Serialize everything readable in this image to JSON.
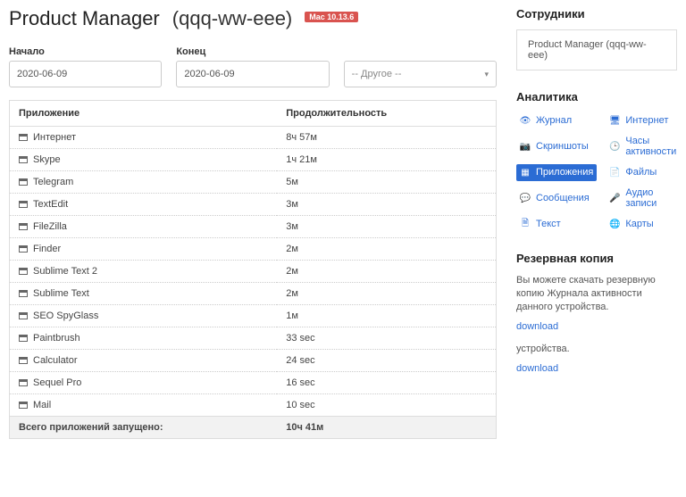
{
  "header": {
    "name": "Product Manager",
    "device": "(qqq-ww-eee)",
    "badge": "Mac 10.13.6"
  },
  "filters": {
    "start_label": "Начало",
    "start_value": "2020-06-09",
    "end_label": "Конец",
    "end_value": "2020-06-09",
    "other_placeholder": "-- Другое --"
  },
  "table": {
    "col_app": "Приложение",
    "col_dur": "Продолжительность",
    "rows": [
      {
        "app": "Интернет",
        "dur": "8ч 57м"
      },
      {
        "app": "Skype",
        "dur": "1ч 21м"
      },
      {
        "app": "Telegram",
        "dur": "5м"
      },
      {
        "app": "TextEdit",
        "dur": "3м"
      },
      {
        "app": "FileZilla",
        "dur": "3м"
      },
      {
        "app": "Finder",
        "dur": "2м"
      },
      {
        "app": "Sublime Text 2",
        "dur": "2м"
      },
      {
        "app": "Sublime Text",
        "dur": "2м"
      },
      {
        "app": "SEO SpyGlass",
        "dur": "1м"
      },
      {
        "app": "Paintbrush",
        "dur": "33 sec"
      },
      {
        "app": "Calculator",
        "dur": "24 sec"
      },
      {
        "app": "Sequel Pro",
        "dur": "16 sec"
      },
      {
        "app": "Mail",
        "dur": "10 sec"
      }
    ],
    "total_label": "Всего приложений запущено:",
    "total_value": "10ч 41м"
  },
  "sidebar": {
    "employees_title": "Сотрудники",
    "employee_value": "Product Manager (qqq-ww-eee)",
    "analytics_title": "Аналитика",
    "analytics": [
      {
        "icon": "eye-icon",
        "label": "Журнал"
      },
      {
        "icon": "monitor-icon",
        "label": "Интернет"
      },
      {
        "icon": "camera-icon",
        "label": "Скриншоты"
      },
      {
        "icon": "clock-icon",
        "label": "Часы активности"
      },
      {
        "icon": "grid-icon",
        "label": "Приложения",
        "active": true
      },
      {
        "icon": "file-icon",
        "label": "Файлы"
      },
      {
        "icon": "chat-icon",
        "label": "Сообщения"
      },
      {
        "icon": "mic-icon",
        "label": "Аудио записи"
      },
      {
        "icon": "text-icon",
        "label": "Текст"
      },
      {
        "icon": "map-icon",
        "label": "Карты"
      }
    ],
    "backup_title": "Резервная копия",
    "backup_text1": "Вы можете скачать резервную копию Журнала активности данного устройства.",
    "backup_link": "download",
    "backup_text2": "устройства."
  }
}
